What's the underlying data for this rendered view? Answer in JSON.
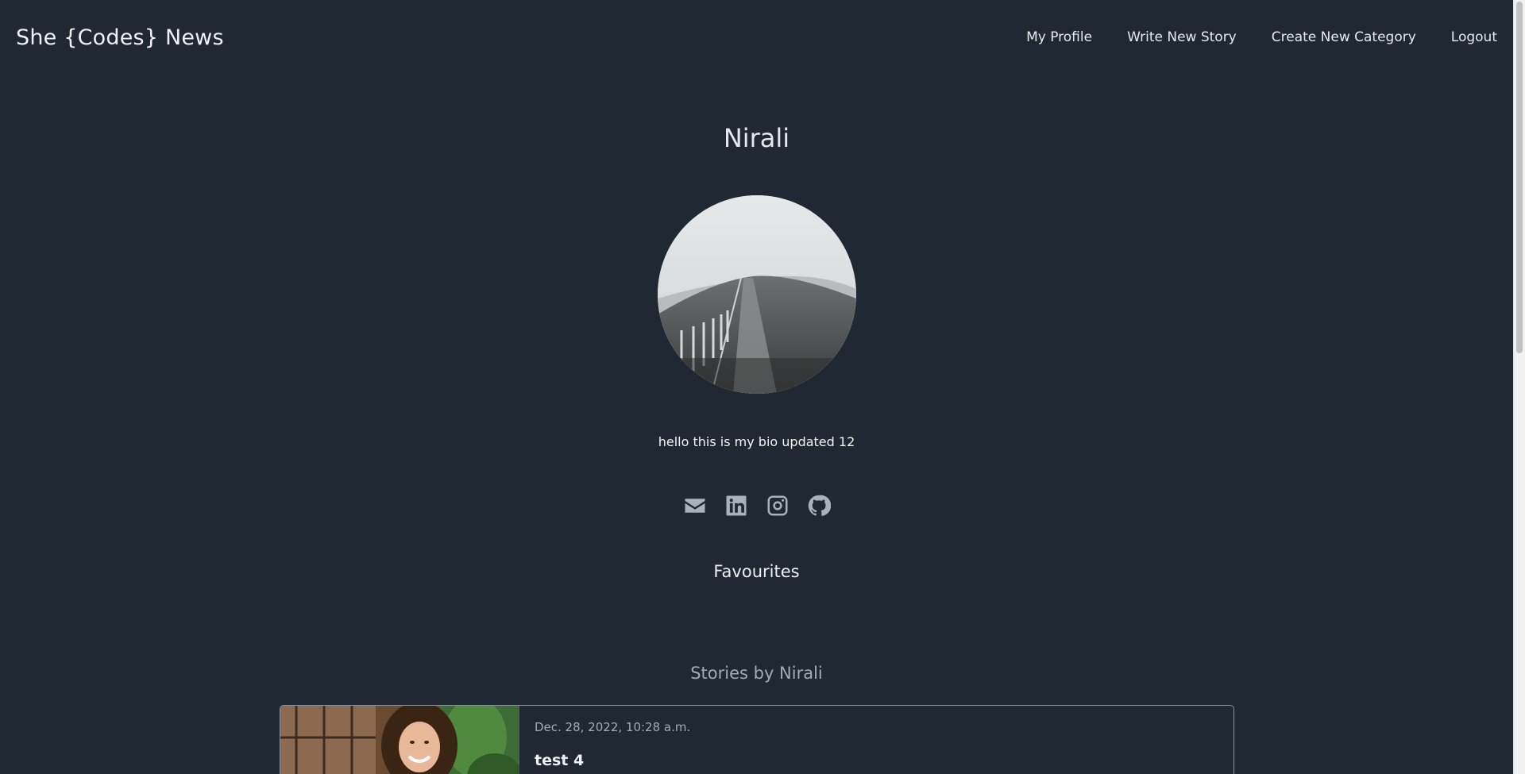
{
  "navbar": {
    "brand": "She {Codes} News",
    "links": [
      {
        "label": "My Profile"
      },
      {
        "label": "Write New Story"
      },
      {
        "label": "Create New Category"
      },
      {
        "label": "Logout"
      }
    ]
  },
  "profile": {
    "name": "Nirali",
    "bio": "hello this is my bio updated 12",
    "socials": [
      {
        "icon": "envelope-icon"
      },
      {
        "icon": "linkedin-icon"
      },
      {
        "icon": "instagram-icon"
      },
      {
        "icon": "github-icon"
      }
    ]
  },
  "favourites": {
    "heading": "Favourites"
  },
  "stories": {
    "heading": "Stories by Nirali",
    "items": [
      {
        "date": "Dec. 28, 2022, 10:28 a.m.",
        "title": "test 4"
      }
    ]
  },
  "colors": {
    "background": "#1f2833",
    "text": "#e9edf2",
    "muted": "#a3abb4",
    "icon": "#a9b1bb"
  }
}
